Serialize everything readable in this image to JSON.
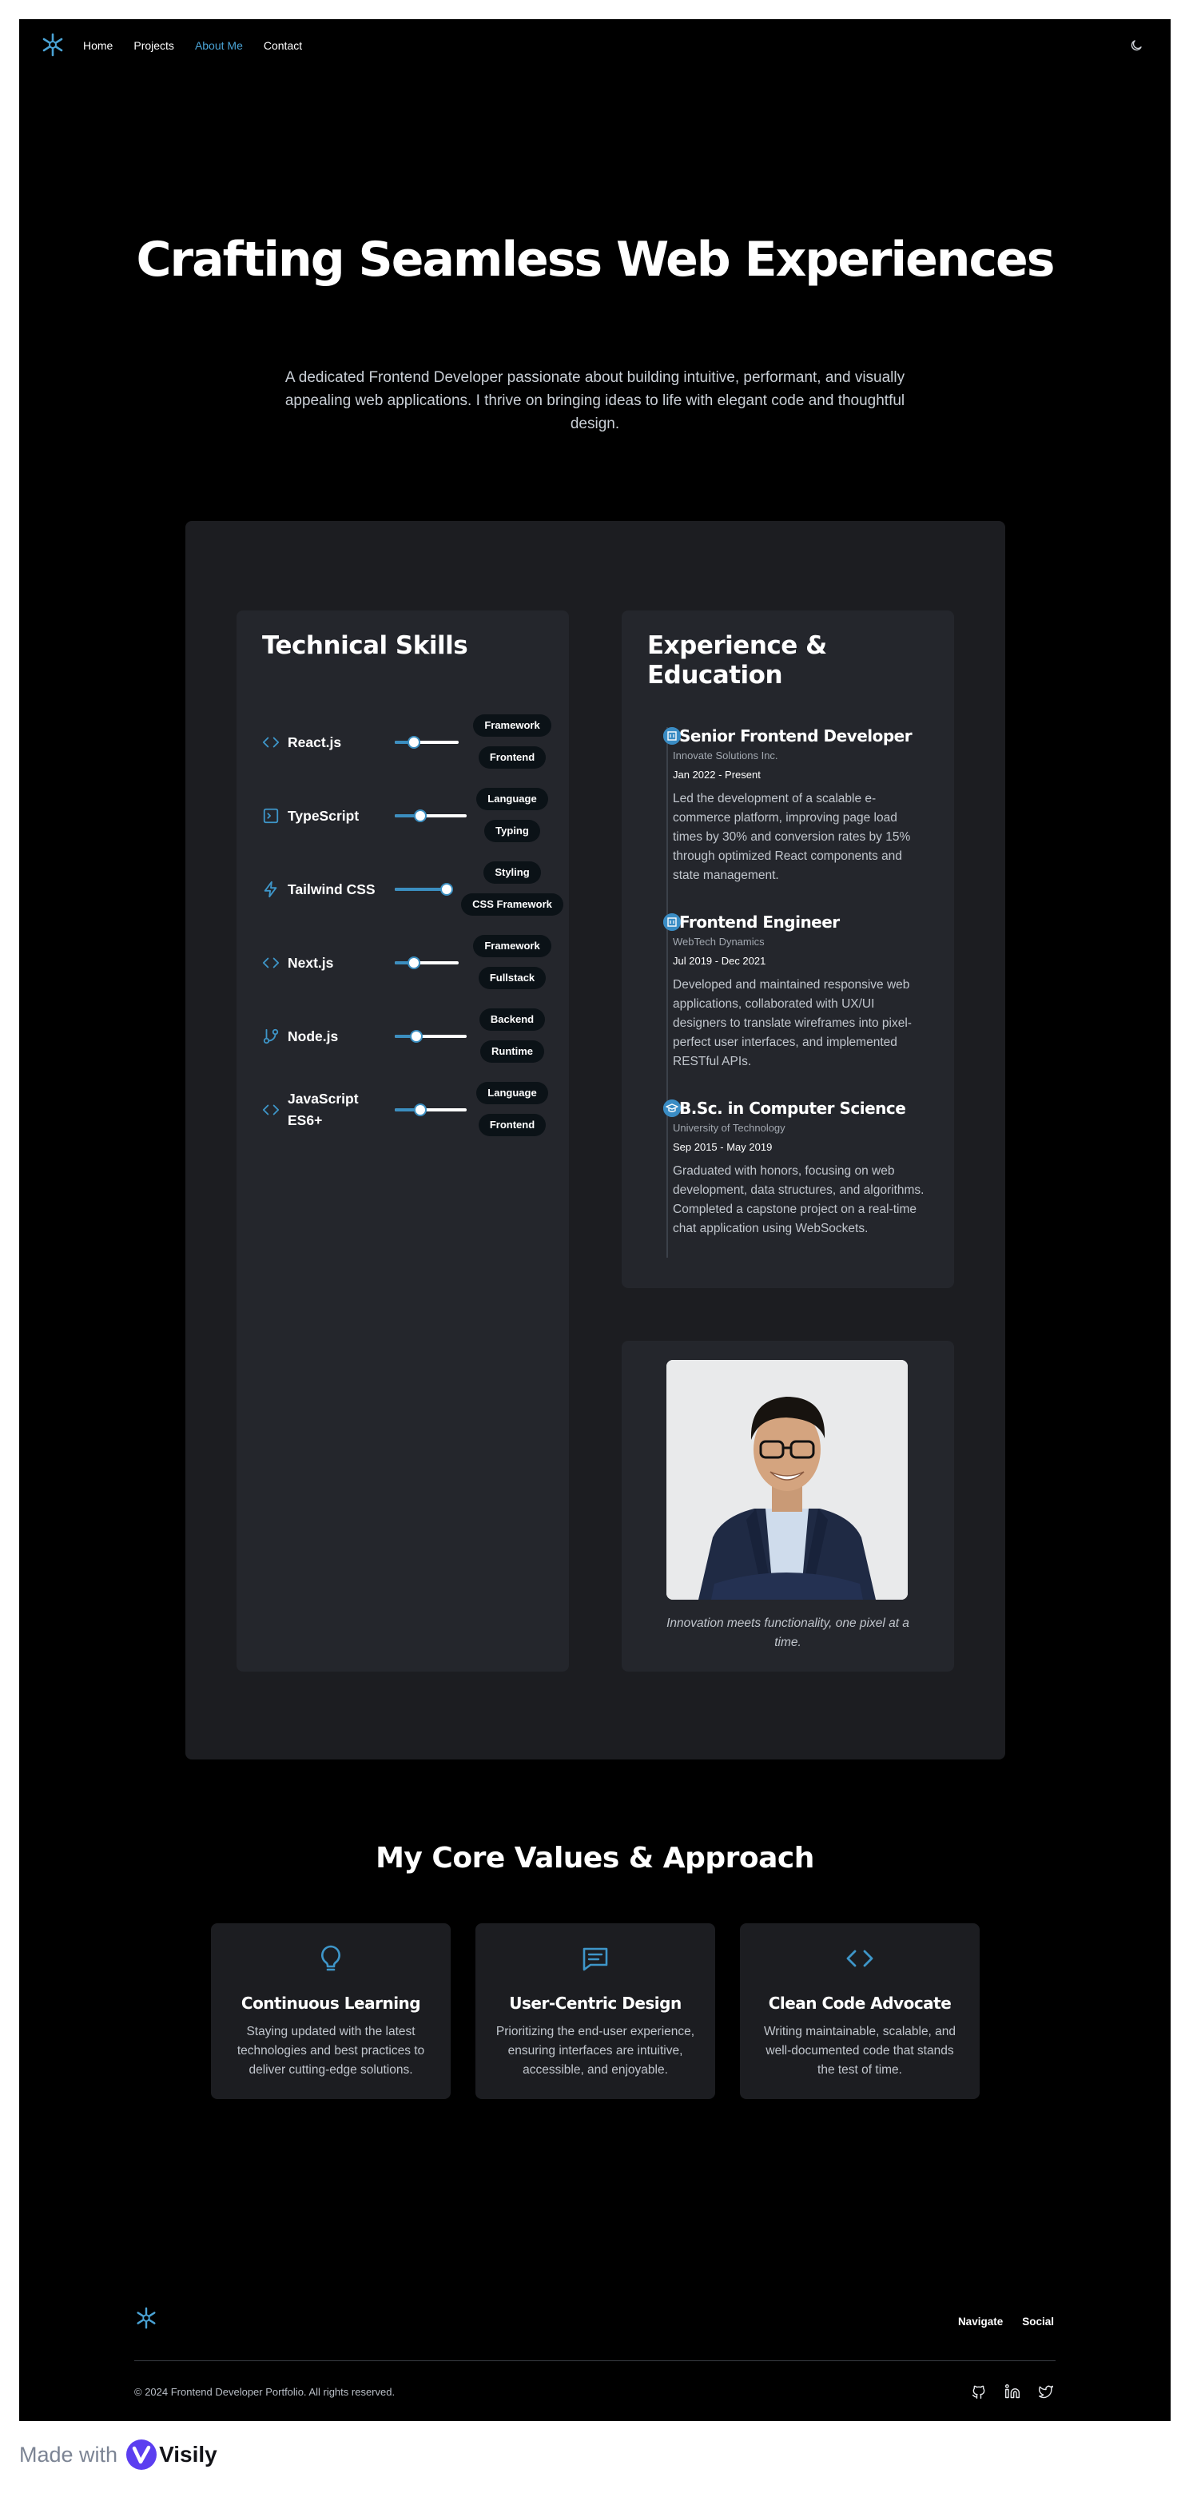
{
  "nav": {
    "links": [
      "Home",
      "Projects",
      "About Me",
      "Contact"
    ],
    "active_index": 2,
    "icons": {
      "logo": "asterisk-logo-icon",
      "theme": "moon-icon"
    }
  },
  "hero": {
    "title": "Crafting Seamless Web Experiences",
    "subtitle": "A dedicated Frontend Developer passionate about building intuitive, performant, and visually appealing web applications. I thrive on bringing ideas to life with elegant code and thoughtful design."
  },
  "skills": {
    "title": "Technical Skills",
    "items": [
      {
        "name": "React.js",
        "icon": "code-icon",
        "level": 0.3,
        "tags": [
          "Framework",
          "Frontend"
        ]
      },
      {
        "name": "TypeScript",
        "icon": "terminal-icon",
        "level": 0.35,
        "tags": [
          "Language",
          "Typing"
        ]
      },
      {
        "name": "Tailwind CSS",
        "icon": "lightning-icon",
        "level": 0.9,
        "tags": [
          "Styling",
          "CSS Framework"
        ]
      },
      {
        "name": "Next.js",
        "icon": "code-icon",
        "level": 0.3,
        "tags": [
          "Framework",
          "Fullstack"
        ]
      },
      {
        "name": "Node.js",
        "icon": "git-branch-icon",
        "level": 0.3,
        "tags": [
          "Backend",
          "Runtime"
        ]
      },
      {
        "name": "JavaScript ES6+",
        "icon": "code-icon",
        "level": 0.35,
        "tags": [
          "Language",
          "Frontend"
        ]
      }
    ]
  },
  "experience": {
    "title": "Experience & Education",
    "entries": [
      {
        "icon": "building-icon",
        "title": "Senior Frontend Developer",
        "org": "Innovate Solutions Inc.",
        "date": "Jan 2022 - Present",
        "desc": "Led the development of a scalable e-commerce platform, improving page load times by 30% and conversion rates by 15% through optimized React components and state management."
      },
      {
        "icon": "building-icon",
        "title": "Frontend Engineer",
        "org": "WebTech Dynamics",
        "date": "Jul 2019 - Dec 2021",
        "desc": "Developed and maintained responsive web applications, collaborated with UX/UI designers to translate wireframes into pixel-perfect user interfaces, and implemented RESTful APIs."
      },
      {
        "icon": "graduation-cap-icon",
        "title": "B.Sc. in Computer Science",
        "org": "University of Technology",
        "date": "Sep 2015 - May 2019",
        "desc": "Graduated with honors, focusing on web development, data structures, and algorithms. Completed a capstone project on a real-time chat application using WebSockets."
      }
    ]
  },
  "profile": {
    "caption": "Innovation meets functionality, one pixel at a time."
  },
  "values": {
    "title": "My Core Values & Approach",
    "cards": [
      {
        "icon": "lightbulb-icon",
        "title": "Continuous Learning",
        "desc": "Staying updated with the latest technologies and best practices to deliver cutting-edge solutions."
      },
      {
        "icon": "message-icon",
        "title": "User-Centric Design",
        "desc": "Prioritizing the end-user experience, ensuring interfaces are intuitive, accessible, and enjoyable."
      },
      {
        "icon": "code-icon",
        "title": "Clean Code Advocate",
        "desc": "Writing maintainable, scalable, and well-documented code that stands the test of time."
      }
    ]
  },
  "footer": {
    "links": [
      "Navigate",
      "Social"
    ],
    "copyright": "© 2024 Frontend Developer Portfolio. All rights reserved.",
    "social_icons": [
      "github-icon",
      "linkedin-icon",
      "twitter-icon"
    ]
  },
  "made_with": {
    "text": "Made with",
    "brand": "Visily"
  },
  "colors": {
    "accent": "#4aa3d5",
    "background": "#000000",
    "panel": "#1c1d21",
    "card": "#24262c"
  }
}
